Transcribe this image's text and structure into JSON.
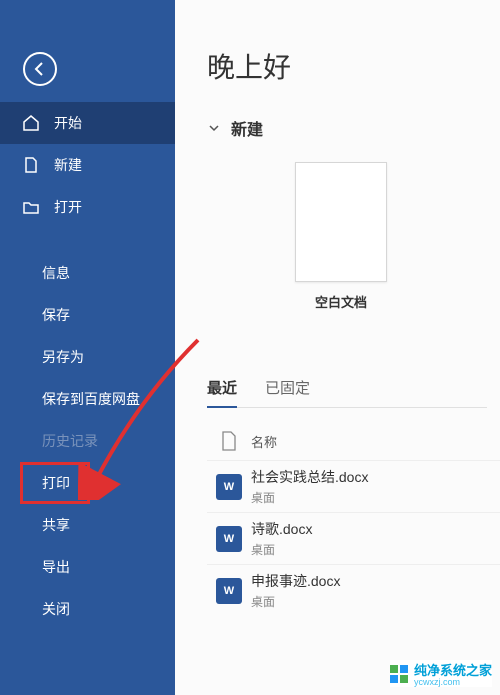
{
  "sidebar": {
    "items": [
      {
        "label": "开始",
        "icon": "home-icon"
      },
      {
        "label": "新建",
        "icon": "file-icon"
      },
      {
        "label": "打开",
        "icon": "folder-icon"
      }
    ],
    "sub_items": [
      {
        "label": "信息"
      },
      {
        "label": "保存"
      },
      {
        "label": "另存为"
      },
      {
        "label": "保存到百度网盘"
      },
      {
        "label": "历史记录",
        "disabled": true
      },
      {
        "label": "打印"
      },
      {
        "label": "共享"
      },
      {
        "label": "导出"
      },
      {
        "label": "关闭"
      }
    ]
  },
  "main": {
    "greeting": "晚上好",
    "new_section": "新建",
    "blank_doc_label": "空白文档",
    "tabs": [
      {
        "label": "最近",
        "active": true
      },
      {
        "label": "已固定",
        "active": false
      }
    ],
    "column_header": "名称",
    "files": [
      {
        "name": "社会实践总结.docx",
        "location": "桌面"
      },
      {
        "name": "诗歌.docx",
        "location": "桌面"
      },
      {
        "name": "申报事迹.docx",
        "location": "桌面"
      }
    ]
  },
  "watermark": {
    "text": "纯净系统之家",
    "sub": "ycwxzj.com"
  }
}
